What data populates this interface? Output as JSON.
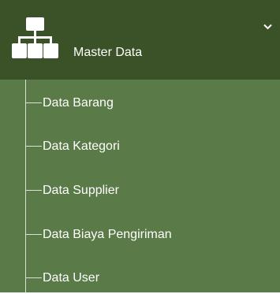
{
  "menu": {
    "header": {
      "icon": "sitemap-icon",
      "label": "Master Data",
      "chevron_icon": "chevron-down-icon"
    },
    "items": [
      {
        "label": "Data Barang"
      },
      {
        "label": "Data Kategori"
      },
      {
        "label": "Data Supplier"
      },
      {
        "label": "Data Biaya Pengiriman"
      },
      {
        "label": "Data User"
      }
    ]
  },
  "colors": {
    "header_bg": "#3b5228",
    "submenu_bg": "#5a7b48",
    "text": "#ffffff",
    "tree_line": "#d8e2cf"
  }
}
